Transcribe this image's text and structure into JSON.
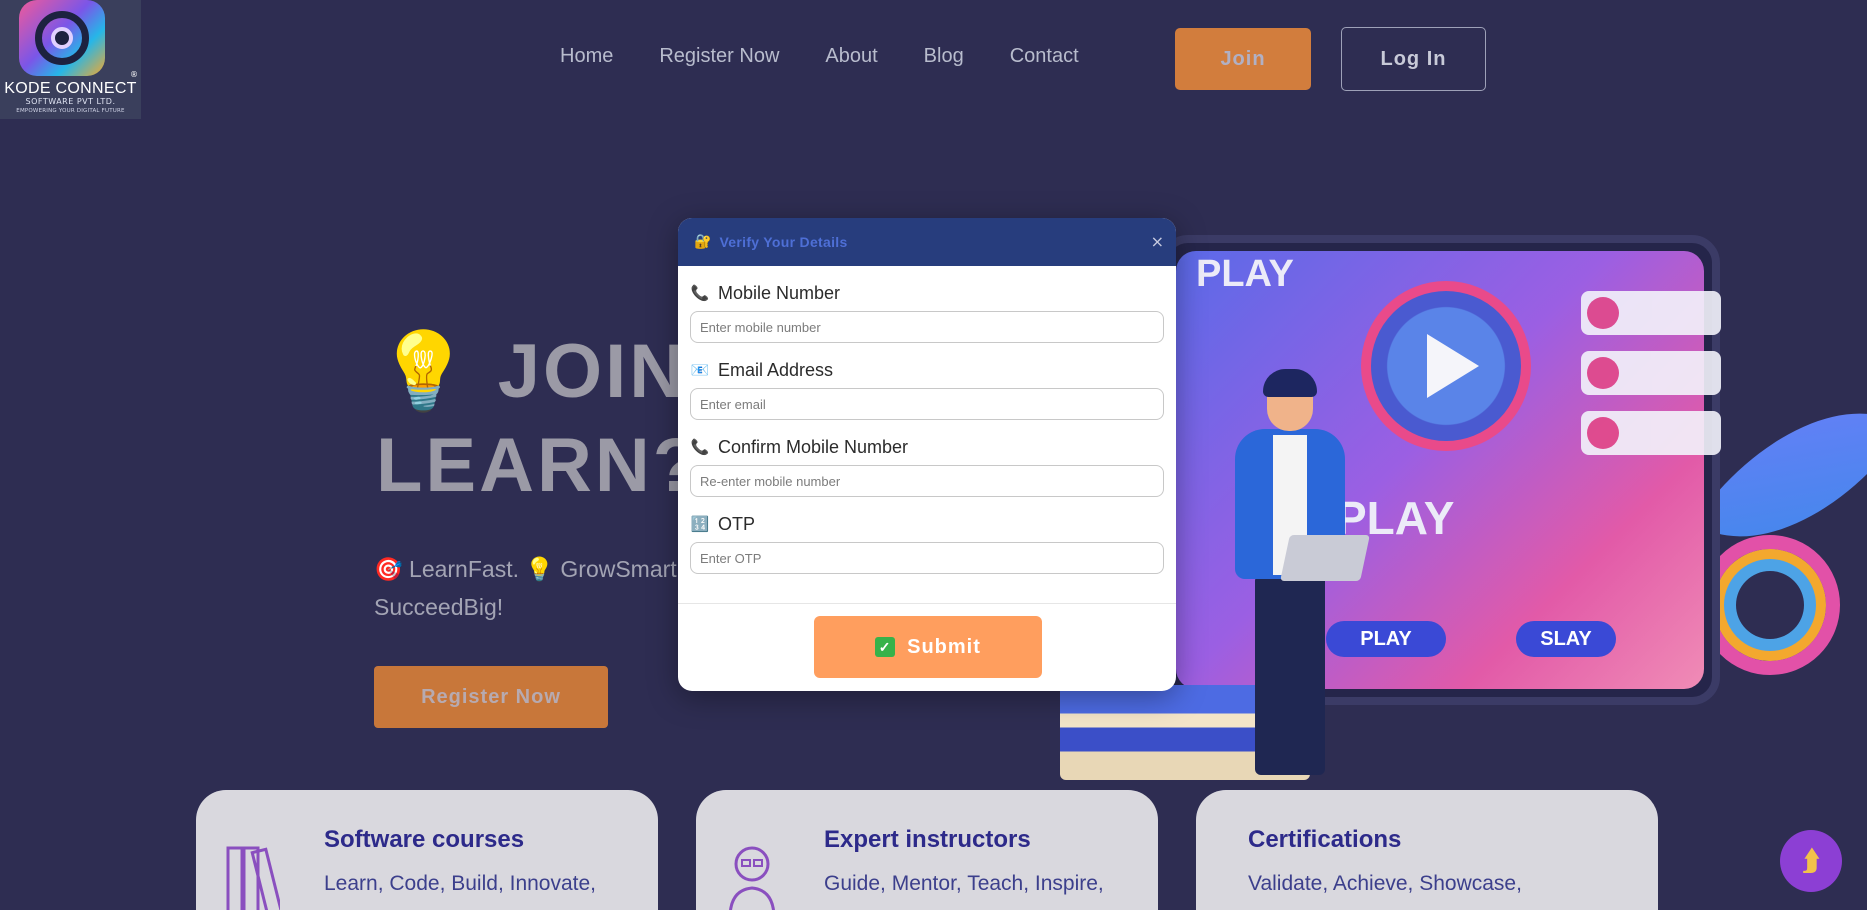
{
  "brand": {
    "name": "KODE CONNECT",
    "subtitle": "SOFTWARE PVT LTD.",
    "tagline": "EMPOWERING YOUR DIGITAL FUTURE",
    "registered_mark": "®"
  },
  "nav": {
    "items": [
      {
        "label": "Home"
      },
      {
        "label": "Register Now"
      },
      {
        "label": "About"
      },
      {
        "label": "Blog"
      },
      {
        "label": "Contact"
      }
    ],
    "join_label": "Join",
    "login_label": "Log In"
  },
  "hero": {
    "title_icon": "💡",
    "title_line1": "JOIN",
    "title_line2": "LEARN?",
    "subtitle_part1": "🎯 LearnFast. 💡 GrowSmart.",
    "subtitle_part2": "SucceedBig!",
    "register_label": "Register Now"
  },
  "illustration": {
    "play_text_top": "PLAY",
    "play_text_mid": "PLAY",
    "pill_left": "PLAY",
    "pill_right": "SLAY"
  },
  "features": [
    {
      "title": "Software courses",
      "text": "Learn, Code, Build, Innovate,",
      "icon": "books-icon"
    },
    {
      "title": "Expert instructors",
      "text": "Guide, Mentor, Teach, Inspire,",
      "icon": "instructor-icon"
    },
    {
      "title": "Certifications",
      "text": "Validate, Achieve, Showcase,",
      "icon": "certificate-icon"
    }
  ],
  "modal": {
    "header_icon": "🔐",
    "title": "Verify Your Details",
    "close_label": "×",
    "fields": [
      {
        "icon": "📞",
        "label": "Mobile Number",
        "placeholder": "Enter mobile number",
        "value": ""
      },
      {
        "icon": "📧",
        "label": "Email Address",
        "placeholder": "Enter email",
        "value": ""
      },
      {
        "icon": "📞",
        "label": "Confirm Mobile Number",
        "placeholder": "Re-enter mobile number",
        "value": ""
      },
      {
        "icon": "🔢",
        "label": "OTP",
        "placeholder": "Enter OTP",
        "value": ""
      }
    ],
    "submit_label": "Submit",
    "submit_icon": "✓"
  },
  "scroll_top_icon": "⮭",
  "colors": {
    "background": "#2e2d52",
    "accent_orange": "#ef8c3a",
    "submit": "#ff9e5e",
    "modal_header": "#273d7d",
    "card": "#d9d8de"
  }
}
